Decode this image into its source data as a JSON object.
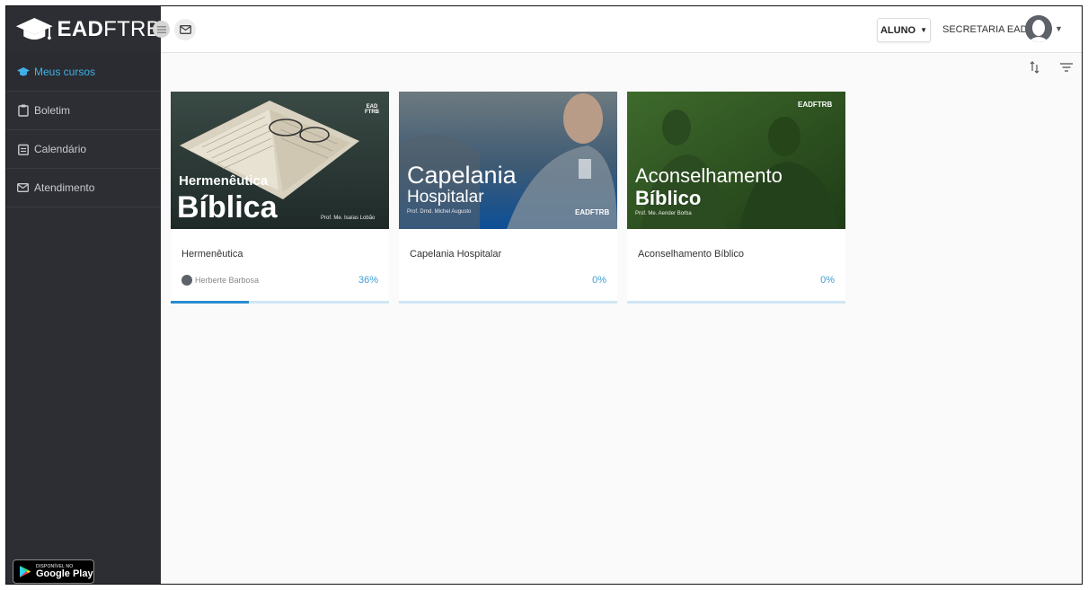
{
  "header": {
    "logo_bold": "EAD",
    "logo_light": "FTRB",
    "role": "ALUNO",
    "user": "SECRETARIA EAD"
  },
  "sidebar": {
    "items": [
      {
        "label": "Meus cursos",
        "icon": "graduation-cap-icon",
        "active": true
      },
      {
        "label": "Boletim",
        "icon": "clipboard-icon"
      },
      {
        "label": "Calendário",
        "icon": "calendar-icon"
      },
      {
        "label": "Atendimento",
        "icon": "envelope-icon"
      }
    ],
    "store_badge": {
      "small": "DISPONÍVEL NO",
      "big": "Google Play"
    }
  },
  "courses": [
    {
      "title": "Hermenêutica",
      "image": {
        "line1": "Hermenêutica",
        "line2": "Bíblica",
        "prof": "Prof. Me. Isaías Lobão",
        "brand": "EAD FTRB"
      },
      "teacher": "Herberte Barbosa",
      "progress_percent": 36,
      "progress_label": "36%"
    },
    {
      "title": "Capelania Hospitalar",
      "image": {
        "line1": "Capelania",
        "line2": "Hospitalar",
        "prof": "Prof. Drnd. Michel Augusto",
        "brand": "EADFTRB"
      },
      "teacher": "",
      "progress_percent": 0,
      "progress_label": "0%"
    },
    {
      "title": "Aconselhamento Bíblico",
      "image": {
        "line1": "Aconselhamento",
        "line2": "Bíblico",
        "prof": "Prof. Me. Aender Borba",
        "brand": "EADFTRB"
      },
      "teacher": "",
      "progress_percent": 0,
      "progress_label": "0%"
    }
  ],
  "colors": {
    "sidebar_bg": "#2c2e33",
    "accent": "#3fb2e8",
    "progress": "#2a8ccf"
  }
}
